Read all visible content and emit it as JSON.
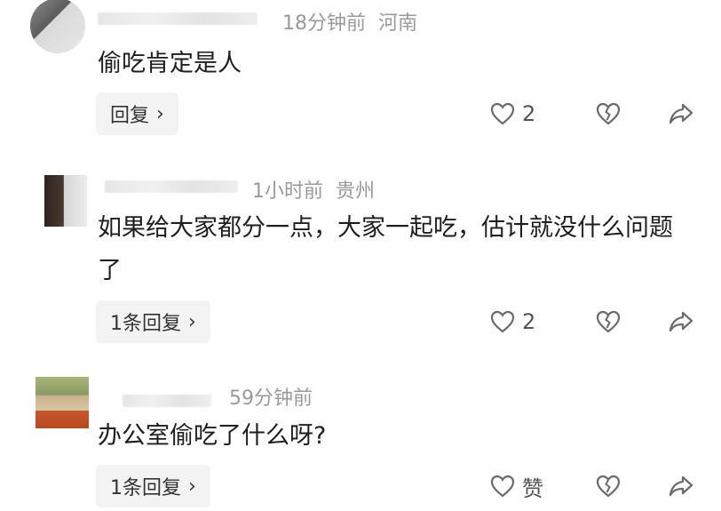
{
  "comments": [
    {
      "time": "18分钟前",
      "location": "河南",
      "text": "偷吃肯定是人",
      "reply_label": "回复",
      "like_count": "2"
    },
    {
      "time": "1小时前",
      "location": "贵州",
      "text": "如果给大家都分一点，大家一起吃，估计就没什么问题了",
      "reply_label": "1条回复",
      "like_count": "2"
    },
    {
      "time": "59分钟前",
      "location": "",
      "text": "办公室偷吃了什么呀?",
      "reply_label": "1条回复",
      "like_count": "赞"
    }
  ],
  "icons": {
    "like": "heart-outline-icon",
    "dislike": "broken-heart-icon",
    "share": "share-arrow-icon",
    "reply_chevron": "chevron-right-icon"
  },
  "colors": {
    "meta": "#9a9a9a",
    "text": "#1e1e1e",
    "reply_bg": "#f3f3f3"
  }
}
